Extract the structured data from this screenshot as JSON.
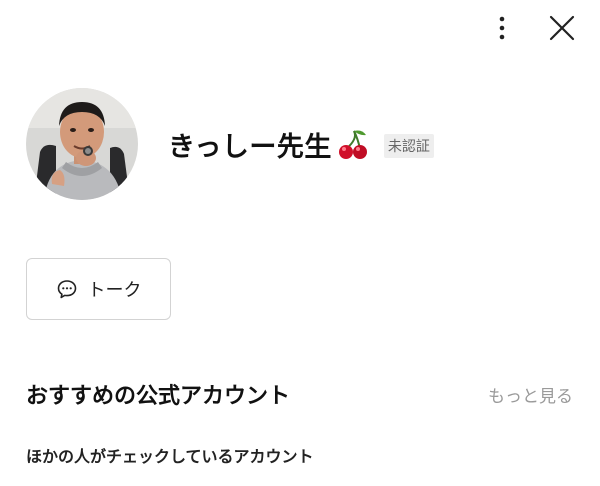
{
  "header": {
    "more_icon": "vertical-ellipsis",
    "close_icon": "close-x"
  },
  "profile": {
    "name": "きっしー先生",
    "emoji": "🍒",
    "badge": "未認証"
  },
  "actions": {
    "talk_label": "トーク",
    "talk_icon": "chat-bubble"
  },
  "recommended": {
    "title": "おすすめの公式アカウント",
    "see_more": "もっと見る",
    "subtitle": "ほかの人がチェックしているアカウント"
  },
  "colors": {
    "badge_bg": "#eeeeee",
    "badge_text": "#666666",
    "see_more": "#9a9a9a",
    "cherry": "#d0102a"
  }
}
